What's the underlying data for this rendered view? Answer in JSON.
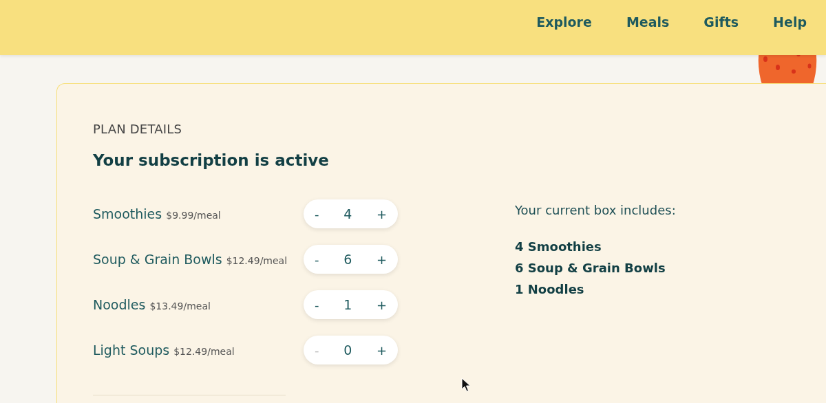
{
  "nav": [
    {
      "label": "Explore"
    },
    {
      "label": "Meals"
    },
    {
      "label": "Gifts"
    },
    {
      "label": "Help"
    }
  ],
  "plan": {
    "eyebrow": "PLAN DETAILS",
    "title": "Your subscription is active",
    "items": [
      {
        "name": "Smoothies",
        "price": "$9.99/meal",
        "quantity": "4",
        "minus": "-",
        "plus": "+",
        "minus_disabled": false
      },
      {
        "name": "Soup & Grain Bowls",
        "price": "$12.49/meal",
        "quantity": "6",
        "minus": "-",
        "plus": "+",
        "minus_disabled": false
      },
      {
        "name": "Noodles",
        "price": "$13.49/meal",
        "quantity": "1",
        "minus": "-",
        "plus": "+",
        "minus_disabled": false
      },
      {
        "name": "Light Soups",
        "price": "$12.49/meal",
        "quantity": "0",
        "minus": "-",
        "plus": "+",
        "minus_disabled": true
      }
    ],
    "summary": {
      "heading": "Your current box includes:",
      "lines": [
        "4 Smoothies",
        "6 Soup & Grain Bowls",
        "1 Noodles"
      ]
    }
  }
}
